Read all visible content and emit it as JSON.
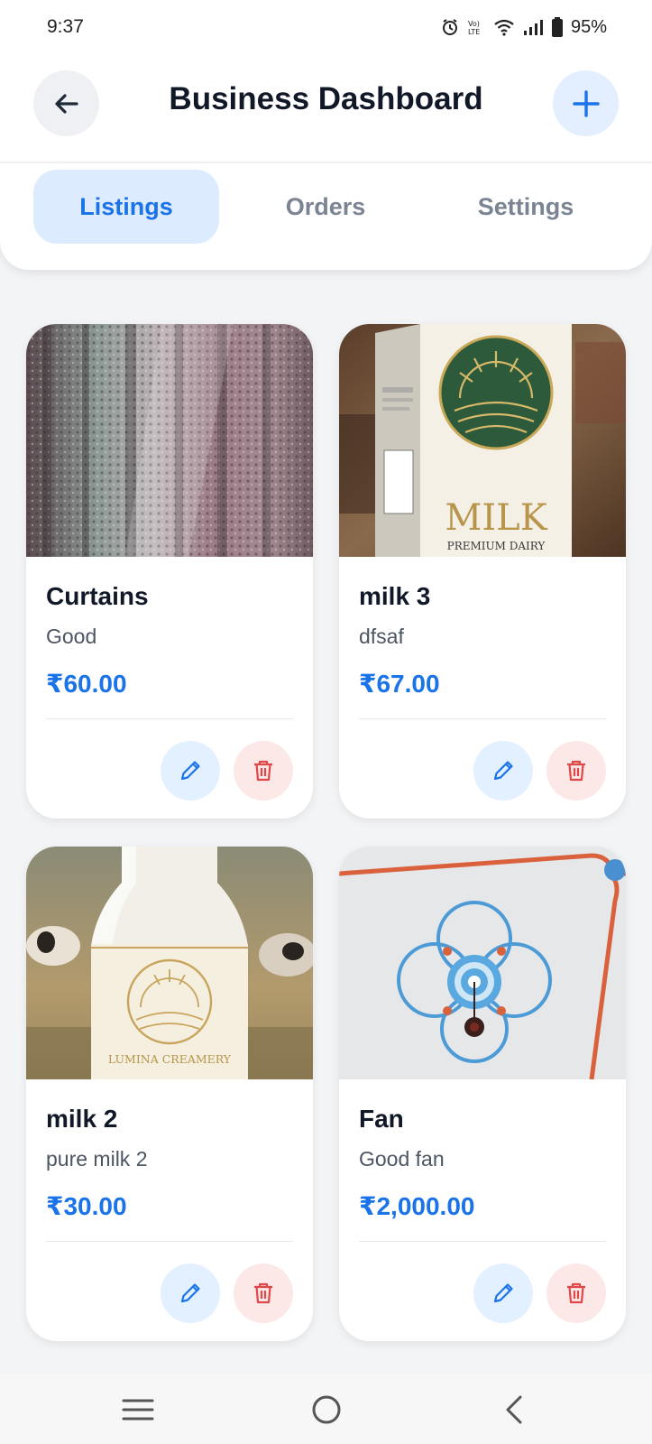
{
  "status_bar": {
    "time": "9:37",
    "battery": "95%",
    "icons": [
      "alarm-icon",
      "volte-icon",
      "wifi-icon",
      "signal-icon",
      "battery-icon"
    ]
  },
  "header": {
    "title": "Business Dashboard",
    "back_icon": "arrow-left-icon",
    "add_icon": "plus-icon"
  },
  "tabs": [
    {
      "label": "Listings",
      "active": true
    },
    {
      "label": "Orders",
      "active": false
    },
    {
      "label": "Settings",
      "active": false
    }
  ],
  "listings": [
    {
      "title": "Curtains",
      "description": "Good",
      "price": "₹60.00",
      "image": "curtains-photo"
    },
    {
      "title": "milk 3",
      "description": "dfsaf",
      "price": "₹67.00",
      "image": "milk-carton-photo"
    },
    {
      "title": "milk 2",
      "description": "pure milk 2",
      "price": "₹30.00",
      "image": "milk-bottle-photo"
    },
    {
      "title": "Fan",
      "description": "Good fan",
      "price": "₹2,000.00",
      "image": "ceiling-fan-photo"
    }
  ],
  "image_text": {
    "milk_carton_brand": "MILK",
    "milk_carton_sub": "PREMIUM DAIRY",
    "milk_bottle_brand": "LUMINA CREAMERY"
  },
  "colors": {
    "accent": "#1a73e8",
    "danger": "#e04848",
    "active_tab_bg": "#dcebfd"
  },
  "nav_bar": {
    "icons": [
      "menu-icon",
      "home-icon",
      "back-icon"
    ]
  }
}
